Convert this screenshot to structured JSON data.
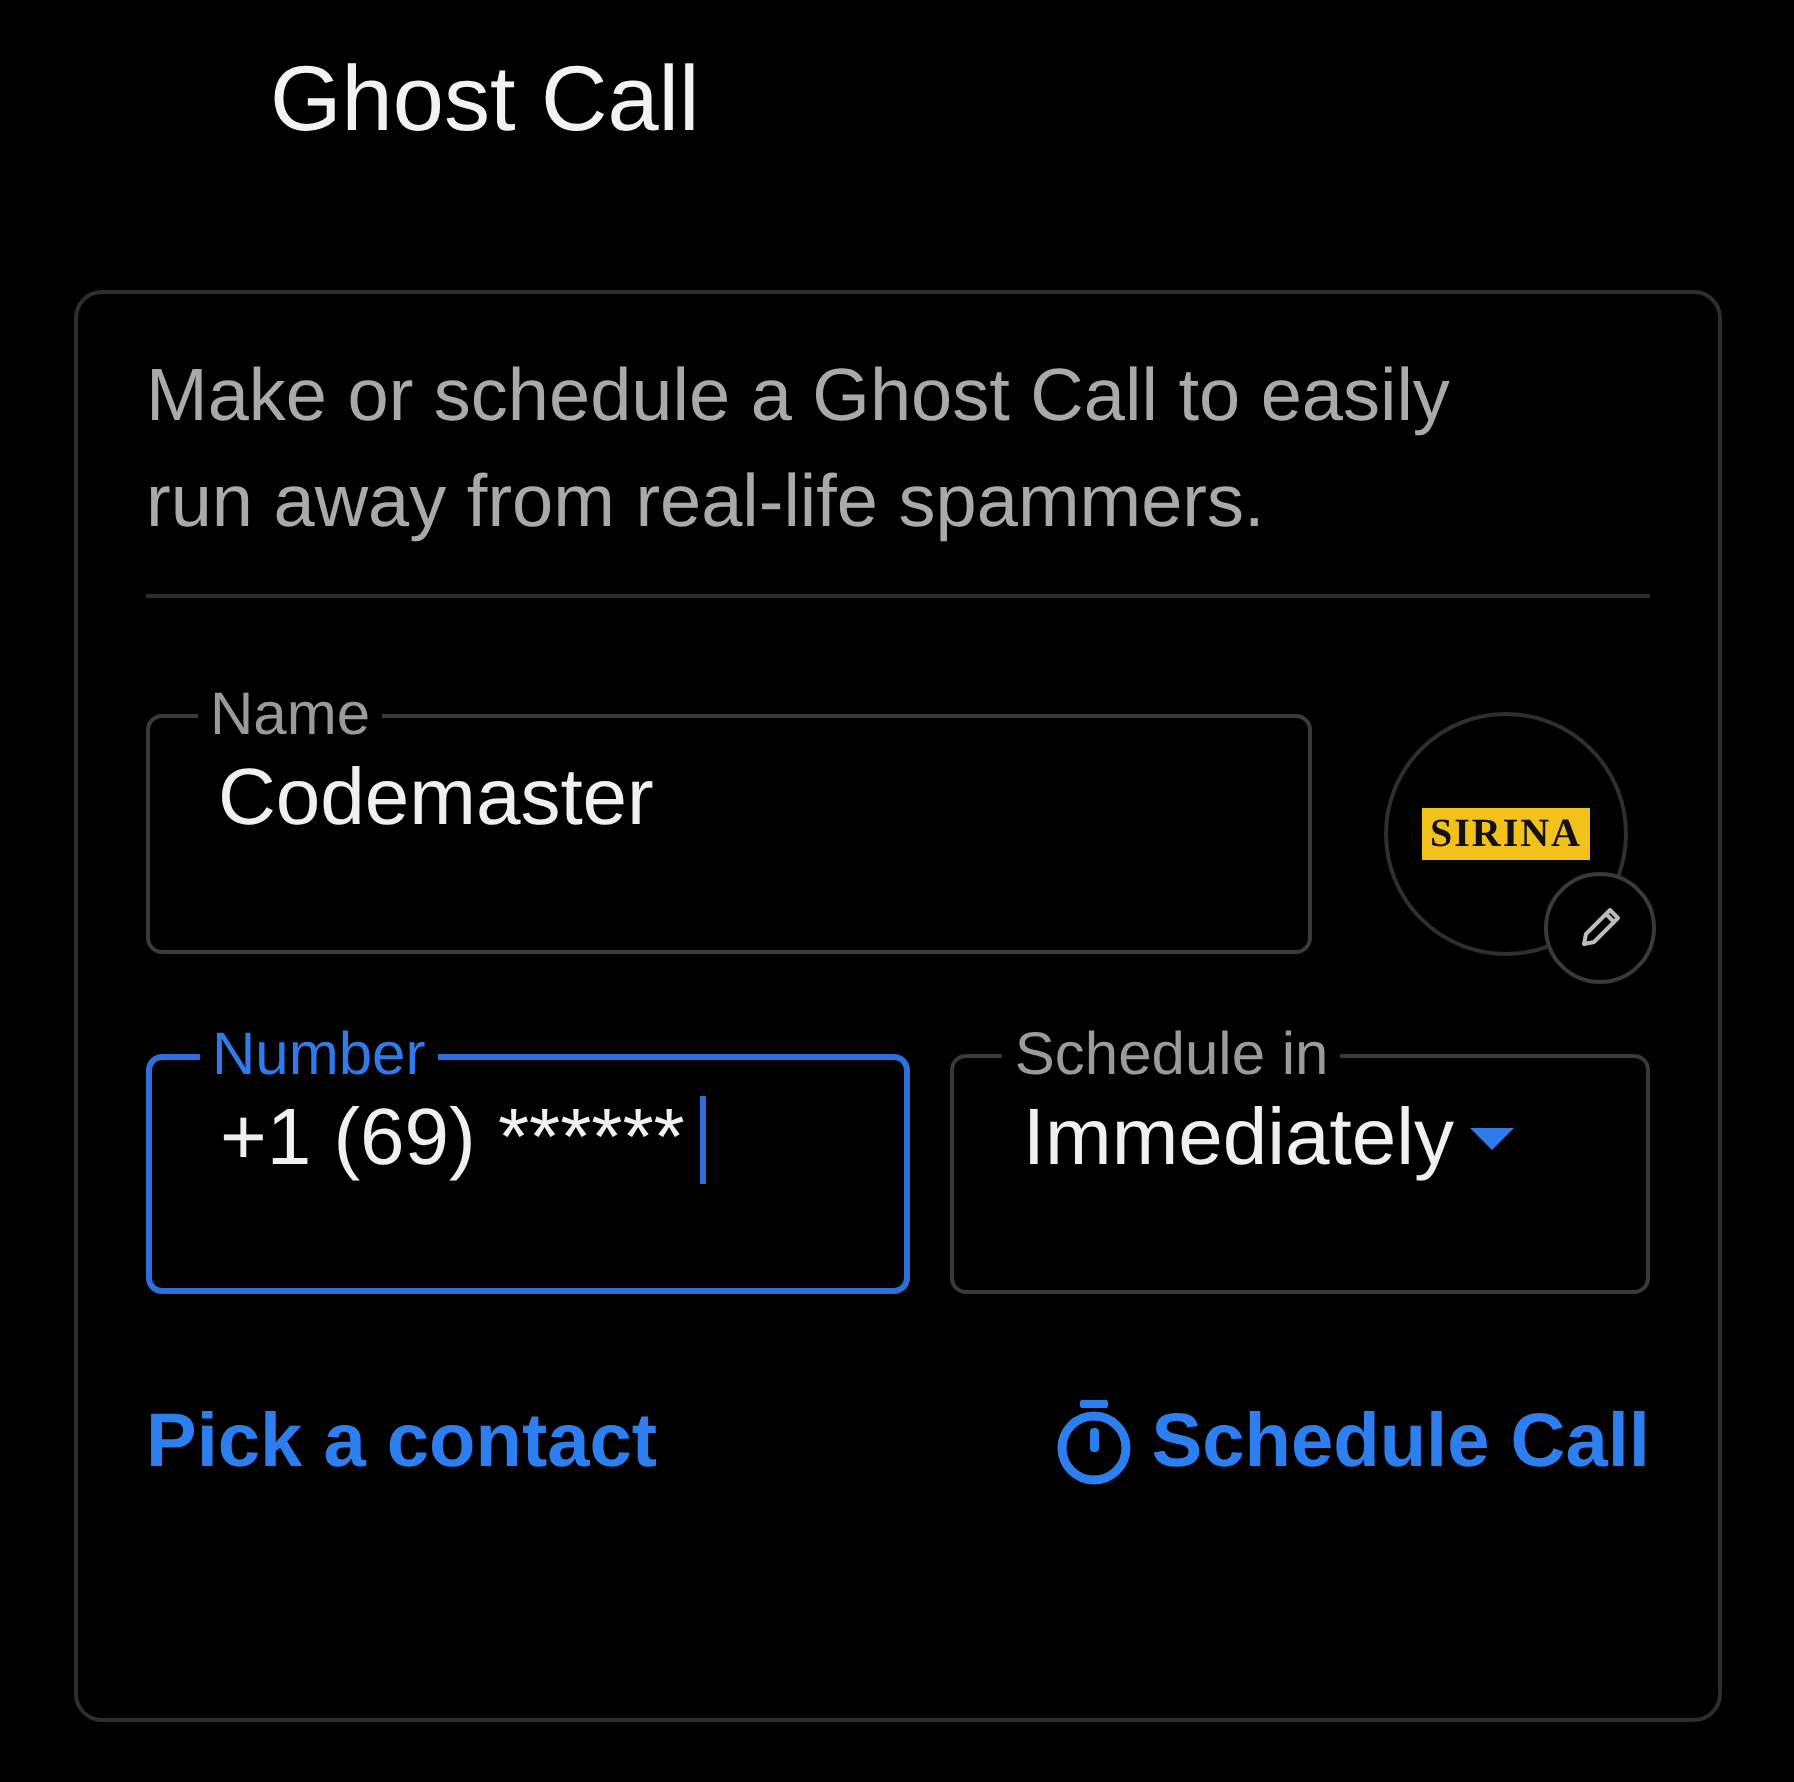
{
  "title": "Ghost Call",
  "card": {
    "description": "Make or schedule a Ghost Call to easily run away from real-life spammers.",
    "name_field": {
      "label": "Name",
      "value": "Codemaster",
      "focused": false
    },
    "avatar": {
      "logo_text": "SIRINA"
    },
    "number_field": {
      "label": "Number",
      "value": "+1 (69) ******",
      "focused": true
    },
    "schedule_field": {
      "label": "Schedule in",
      "value": "Immediately",
      "focused": false
    },
    "actions": [
      {
        "kind": "link",
        "label": "Pick a contact"
      },
      {
        "kind": "timer",
        "label": "Schedule Call"
      }
    ]
  }
}
